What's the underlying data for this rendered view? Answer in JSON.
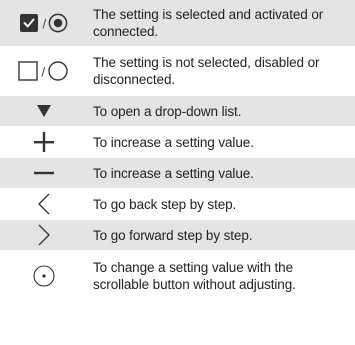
{
  "colors": {
    "shade": "#e4e4e4",
    "icon": "#333333",
    "text": "#222222"
  },
  "rows": [
    {
      "icon": "checkbox-checked-and-radio-selected",
      "separator": "/",
      "text": "The setting is selected and activated or connected."
    },
    {
      "icon": "checkbox-empty-and-radio-empty",
      "separator": "/",
      "text": "The setting is not selected, disabled or disconnected."
    },
    {
      "icon": "triangle-down",
      "text": "To open a drop-down list."
    },
    {
      "icon": "plus",
      "text": "To increase a setting value."
    },
    {
      "icon": "minus",
      "text": "To increase a setting value."
    },
    {
      "icon": "chevron-left",
      "text": "To go back step by step."
    },
    {
      "icon": "chevron-right",
      "text": "To go forward step by step."
    },
    {
      "icon": "dotted-circle",
      "text": "To change a setting value with the scrollable button without adjusting."
    }
  ]
}
